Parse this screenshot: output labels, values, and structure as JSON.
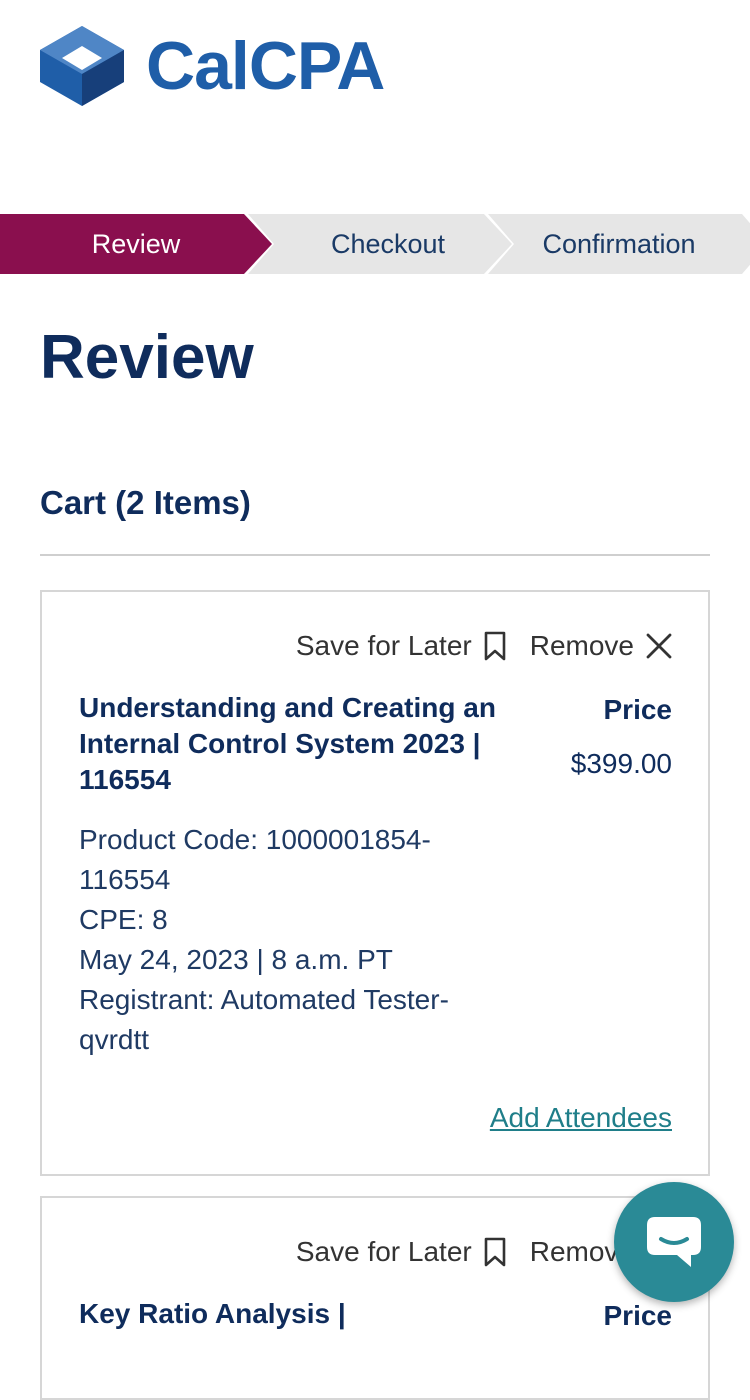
{
  "header": {
    "logo_text": "CalCPA"
  },
  "steps": [
    {
      "label": "Review",
      "state": "active"
    },
    {
      "label": "Checkout",
      "state": "inactive"
    },
    {
      "label": "Confirmation",
      "state": "inactive"
    }
  ],
  "page_title": "Review",
  "cart": {
    "title": "Cart (2 Items)",
    "items": [
      {
        "save_label": "Save for Later",
        "remove_label": "Remove",
        "title": "Understanding and Creating an Internal Control System 2023 | 116554",
        "price_label": "Price",
        "price": "$399.00",
        "details": {
          "product_code_line1": "Product Code: 1000001854-",
          "product_code_line2": "116554",
          "cpe": "CPE: 8",
          "date": "May 24, 2023 | 8 a.m. PT",
          "registrant_line1": "Registrant: Automated Tester-",
          "registrant_line2": "qvrdtt"
        },
        "add_attendees_label": "Add Attendees"
      },
      {
        "save_label": "Save for Later",
        "remove_label": "Remove",
        "title": "Key Ratio Analysis |",
        "price_label": "Price"
      }
    ]
  },
  "colors": {
    "brand_blue": "#1f5ea8",
    "active_step": "#8a0f4e",
    "navy": "#0f2c5c",
    "link_teal": "#1f7e89",
    "chat_teal": "#2a8a96"
  },
  "icons": {
    "logo": "calcpa-cube-icon",
    "save": "bookmark-icon",
    "remove": "close-icon",
    "chat": "chat-bubble-icon"
  }
}
